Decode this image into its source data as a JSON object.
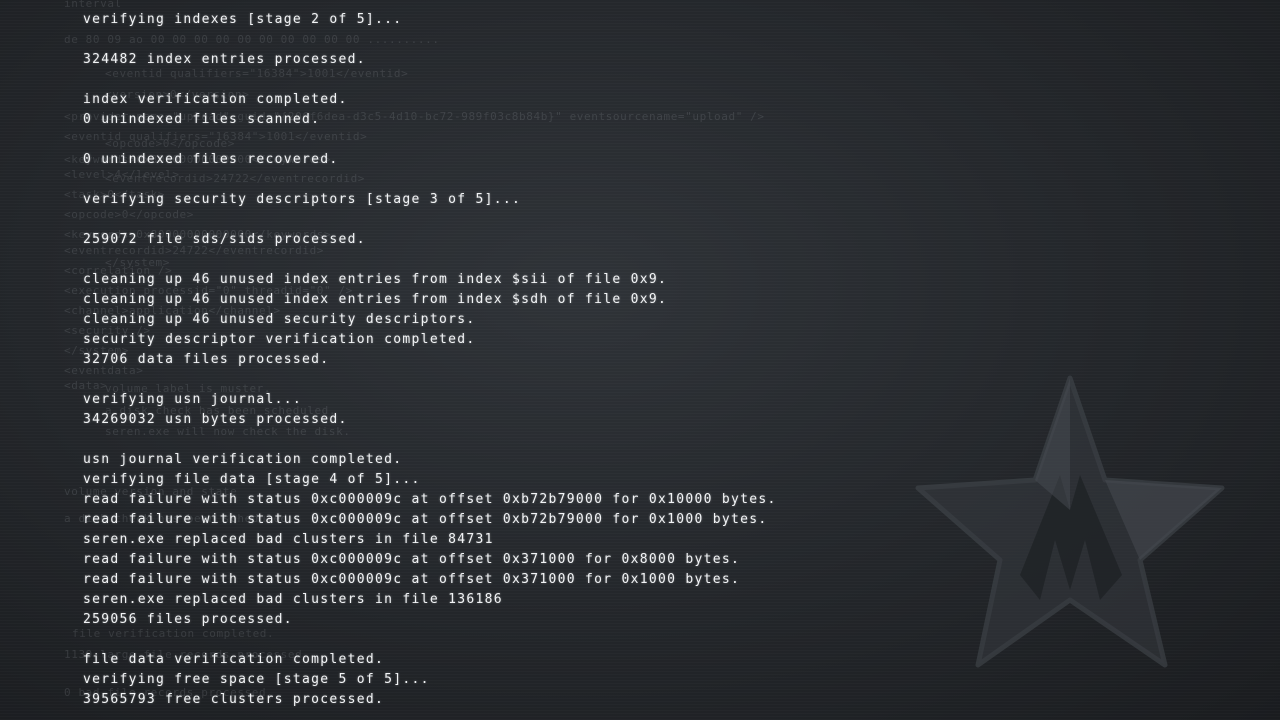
{
  "console": {
    "lines": [
      "verifying indexes [stage 2 of 5]...",
      "",
      "324482 index entries processed.",
      "",
      "index verification completed.",
      "0 unindexed files scanned.",
      "",
      "0 unindexed files recovered.",
      "",
      "verifying security descriptors [stage 3 of 5]...",
      "",
      "259072 file sds/sids processed.",
      "",
      "cleaning up 46 unused index entries from index $sii of file 0x9.",
      "cleaning up 46 unused index entries from index $sdh of file 0x9.",
      "cleaning up 46 unused security descriptors.",
      "security descriptor verification completed.",
      "32706 data files processed.",
      "",
      "verifying usn journal...",
      "34269032 usn bytes processed.",
      "",
      "usn journal verification completed.",
      "verifying file data [stage 4 of 5]...",
      "read failure with status 0xc000009c at offset 0xb72b79000 for 0x10000 bytes.",
      "read failure with status 0xc000009c at offset 0xb72b79000 for 0x1000 bytes.",
      "seren.exe replaced bad clusters in file 84731",
      "read failure with status 0xc000009c at offset 0x371000 for 0x8000 bytes.",
      "read failure with status 0xc000009c at offset 0x371000 for 0x1000 bytes.",
      "seren.exe replaced bad clusters in file 136186",
      "259056 files processed.",
      "",
      "file data verification completed.",
      "verifying free space [stage 5 of 5]...",
      "39565793 free clusters processed."
    ]
  },
  "background_text": [
    "interval",
    "de 80 09 ao 00 00 00 00 00 00 00 00 00 00 ..........",
    "<eventid qualifiers=\"16384\">1001</eventid>",
    "<version>0</version>",
    "<provider name=\"upload\" guid=\"{206f6dea-d3c5-4d10-bc72-989f03c8b84b}\" eventsourcename=\"upload\" />",
    "<eventid qualifiers=\"16384\">1001</eventid>",
    "<opcode>0</opcode>",
    "<keywords>0x80000000000000</keywords>",
    "<eventrecordid>24722</eventrecordid>",
    "<level>4</level>",
    "<task>0</task>",
    "<opcode>0</opcode>",
    "<keywords>0x80000000000000</keywords>",
    "<eventrecordid>24722</eventrecordid>",
    "</system>",
    "<correlation />",
    "<execution processid=\"0\" threadid=\"0\" />",
    "<channel>application</channel>",
    "<security />",
    "</system>",
    "<eventdata>",
    "<data>",
    "volume label is muster.",
    "a disk check has been scheduled.",
    "seren.exe will now check the disk.",
    "volume version and state",
    "a disk check has been scheduled.",
    "file verification completed.",
    "1139 large file records processed.",
    "0 bad file records processed."
  ]
}
